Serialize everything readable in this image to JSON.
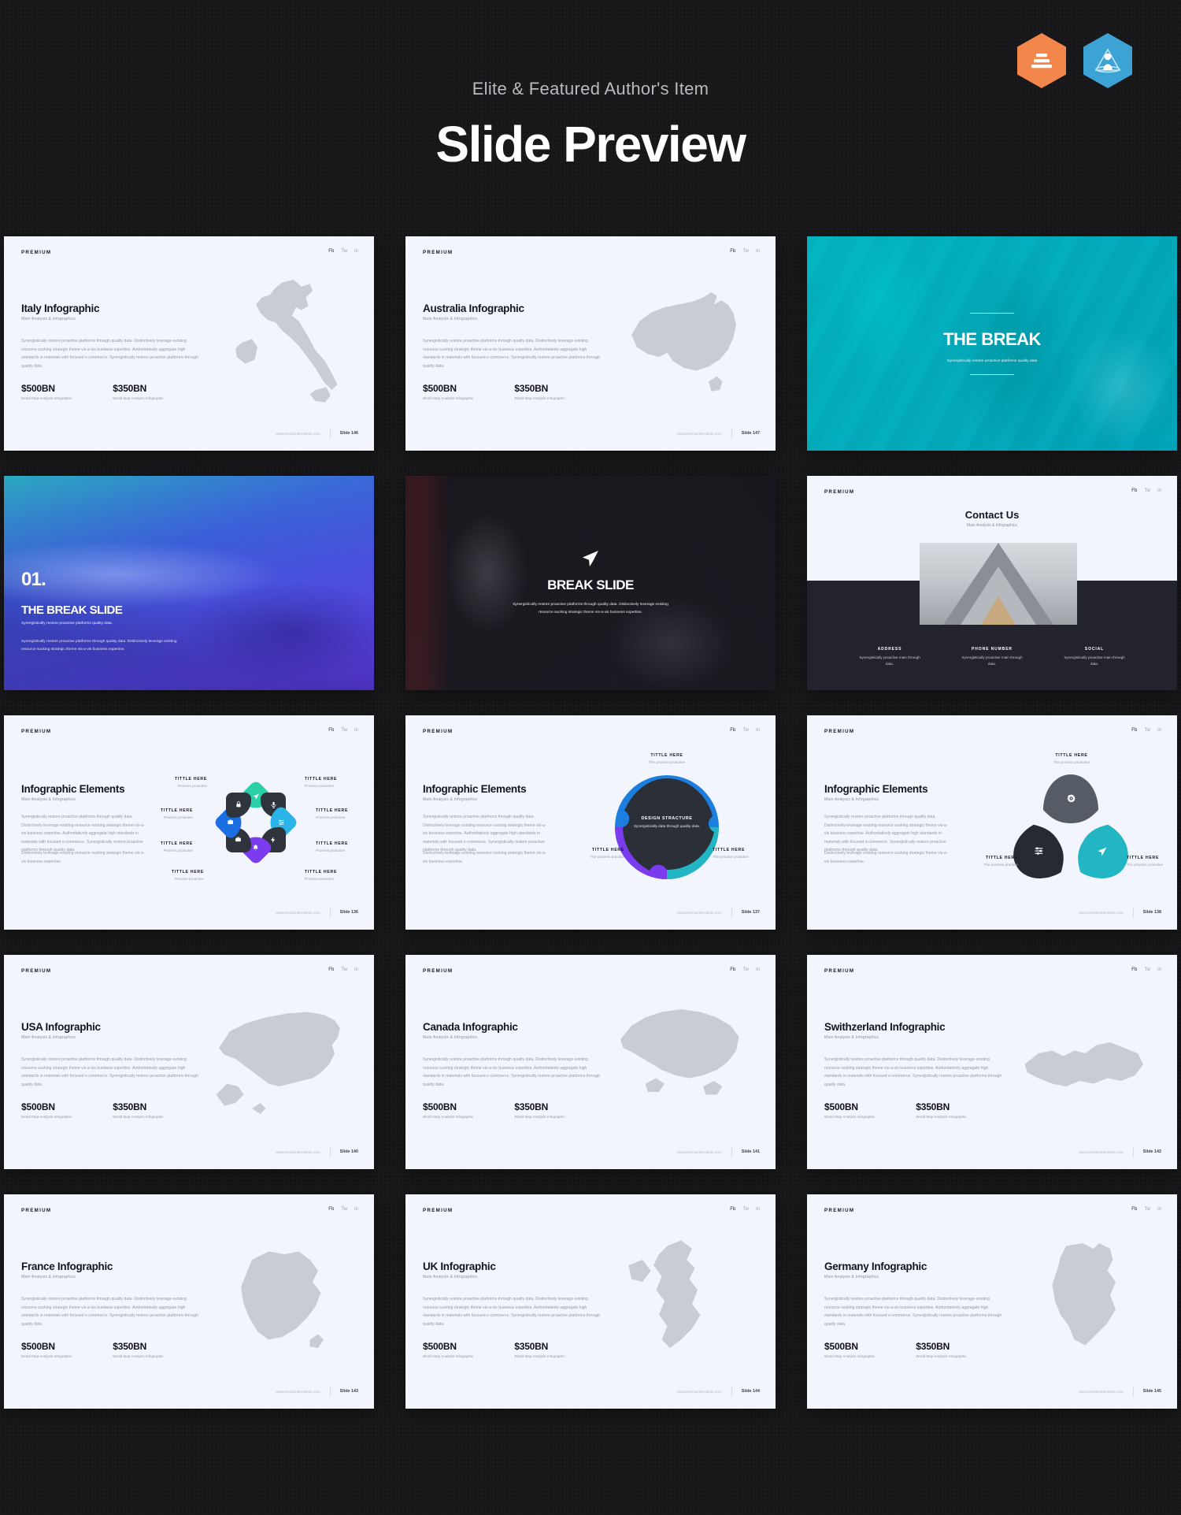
{
  "header": {
    "eyebrow": "Elite & Featured Author's Item",
    "title": "Slide Preview",
    "badges": [
      {
        "name": "elite-author-badge",
        "color": "#f2864b"
      },
      {
        "name": "featured-author-badge",
        "color": "#3da3d4"
      }
    ]
  },
  "common": {
    "brand": "PREMIUM",
    "subtitle": "Main Analysis & Infographics",
    "body": "Synergistically restore proactive platforms through quality data. Distinctively leverage existing resource sucking strategic theme vis-a-vis business expertise. Authoritatively aggregate high standards in materials with focused e-commerce. Synergistically restore proactive platforms through quality data.",
    "stat1_value": "$500BN",
    "stat1_label": "World Map Analysis Infographic",
    "stat2_value": "$350BN",
    "stat2_label": "World Map Analysis Infographic",
    "footer_url": "www.premiumtemplate.com",
    "title_here": "TITTLE HERE",
    "process_practice": "Process proactive",
    "the_process_practice": "The process practice"
  },
  "slides": [
    {
      "id": "italy-infographic",
      "kind": "map",
      "title": "Italy Infographic",
      "subtitle": "Main Analysis & Infographics",
      "slide_number": "Slide  146",
      "map": "italy"
    },
    {
      "id": "australia-infographic",
      "kind": "map",
      "title": "Australia Infographic",
      "subtitle": "Main Analysis & Infographics",
      "slide_number": "Slide  147",
      "map": "australia"
    },
    {
      "id": "the-break",
      "kind": "break-teal",
      "title": "THE BREAK",
      "subtitle": "Synergistically restore proactive platforms quality data"
    },
    {
      "id": "the-break-slide",
      "kind": "break-purple",
      "number": "01.",
      "title": "THE BREAK SLIDE",
      "subtitle": "Synergistically restore proactive platforms quality data.",
      "body": "Synergistically restore proactive platforms through quality data. Distinctively leverage existing resource sucking strategic theme vis-a-vis business expertise."
    },
    {
      "id": "break-slide",
      "kind": "break-dark",
      "title": "BREAK SLIDE",
      "subtitle": "Synergistically restore proactive platforms through quality data. Distinctively leverage existing resource sucking strategic theme vis-a-vis business expertise.",
      "icon": "paper-plane-icon"
    },
    {
      "id": "contact-us",
      "kind": "contact",
      "title": "Contact Us",
      "subtitle": "Main Analysis & Infographics",
      "columns": [
        {
          "heading": "ADDRESS",
          "text": "Synergistically proactive main through data."
        },
        {
          "heading": "PHONE NUMBER",
          "text": "Synergistically proactive main through data."
        },
        {
          "heading": "SOCIAL",
          "text": "Synergistically proactive main through data."
        }
      ]
    },
    {
      "id": "infographic-elements-circle",
      "kind": "ig-circle",
      "title": "Infographic Elements",
      "subtitle": "Main Analysis & Infographics",
      "body": "Synergistically restore proactive platforms through quality data. Distinctively leverage existing resource sucking strategic theme vis-a-vis business expertise. Authoritatively aggregate high standards in materials with focused e-commerce. Synergistically restore proactive platforms through quality data.",
      "body2": "Distinctively leverage existing resource sucking strategic theme vis-a-vis business expertise.",
      "slide_number": "Slide  136",
      "segments": [
        {
          "icon": "paper-plane-icon",
          "color": "#2ad1a8"
        },
        {
          "icon": "microphone-icon",
          "color": "#2f333c"
        },
        {
          "icon": "sliders-icon",
          "color": "#2ab4e8"
        },
        {
          "icon": "flash-icon",
          "color": "#2f333c"
        },
        {
          "icon": "bell-icon",
          "color": "#7b3cf0"
        },
        {
          "icon": "briefcase-icon",
          "color": "#2f333c"
        },
        {
          "icon": "camera-icon",
          "color": "#1c6fe0"
        },
        {
          "icon": "lock-icon",
          "color": "#2f333c"
        }
      ]
    },
    {
      "id": "infographic-elements-globe",
      "kind": "ig-globe",
      "title": "Infographic Elements",
      "subtitle": "Main Analysis & Infographics",
      "body": "Synergistically restore proactive platforms through quality data. Distinctively leverage existing resource sucking strategic theme vis-a-vis business expertise. Authoritatively aggregate high standards in materials with focused e-commerce. Synergistically restore proactive platforms through quality data.",
      "body2": "Distinctively leverage existing resource sucking strategic theme vis-a-vis business expertise.",
      "slide_number": "Slide  137",
      "center_heading": "DESIGN STRACTURE",
      "center_text": "Synergistically data through quality data.",
      "labels": [
        {
          "title": "TITTLE HERE",
          "desc": "The process proactive"
        },
        {
          "title": "TITTLE HERE",
          "desc": "The process practice"
        },
        {
          "title": "TITTLE HERE",
          "desc": "The practice proactive"
        }
      ],
      "colors": [
        "#1c7fe0",
        "#7b3cf0",
        "#22b6c4",
        "#2b2f38"
      ]
    },
    {
      "id": "infographic-elements-triangles",
      "kind": "ig-triangles",
      "title": "Infographic Elements",
      "subtitle": "Main Analysis & Infographics",
      "body": "Synergistically restore proactive platforms through quality data. Distinctively leverage existing resource sucking strategic theme vis-a-vis business expertise. Authoritatively aggregate high standards in materials with focused e-commerce. Synergistically restore proactive platforms through quality data.",
      "body2": "Distinctively leverage existing resource sucking strategic theme vis-a-vis business expertise.",
      "slide_number": "Slide  138",
      "items": [
        {
          "title": "TITTLE HERE",
          "desc": "The process proactive",
          "icon": "gear-icon",
          "color": "#555c66"
        },
        {
          "title": "TITTLE HERE",
          "desc": "The process practice",
          "icon": "sliders-icon",
          "color": "#262a33"
        },
        {
          "title": "TITTLE HERE",
          "desc": "The practice proactive",
          "icon": "paper-plane-icon",
          "color": "#22b6c4"
        }
      ]
    },
    {
      "id": "usa-infographic",
      "kind": "map",
      "title": "USA Infographic",
      "subtitle": "Main Analysis & Infographics",
      "slide_number": "Slide  140",
      "map": "usa"
    },
    {
      "id": "canada-infographic",
      "kind": "map",
      "title": "Canada Infographic",
      "subtitle": "Main Analysis & Infographics",
      "slide_number": "Slide  141",
      "map": "canada"
    },
    {
      "id": "swithzerland-infographic",
      "kind": "map",
      "title": "Swithzerland Infographic",
      "subtitle": "Main Analysis & Infographics",
      "slide_number": "Slide  142",
      "map": "switzerland"
    },
    {
      "id": "france-infographic",
      "kind": "map",
      "title": "France Infographic",
      "subtitle": "Main Analysis & Infographics",
      "slide_number": "Slide  143",
      "map": "france"
    },
    {
      "id": "uk-infographic",
      "kind": "map",
      "title": "UK Infographic",
      "subtitle": "Main Analysis & Infographics",
      "slide_number": "Slide  144",
      "map": "uk"
    },
    {
      "id": "germany-infographic",
      "kind": "map",
      "title": "Germany Infographic",
      "subtitle": "Main Analysis & Infographics",
      "slide_number": "Slide  145",
      "map": "germany"
    }
  ]
}
